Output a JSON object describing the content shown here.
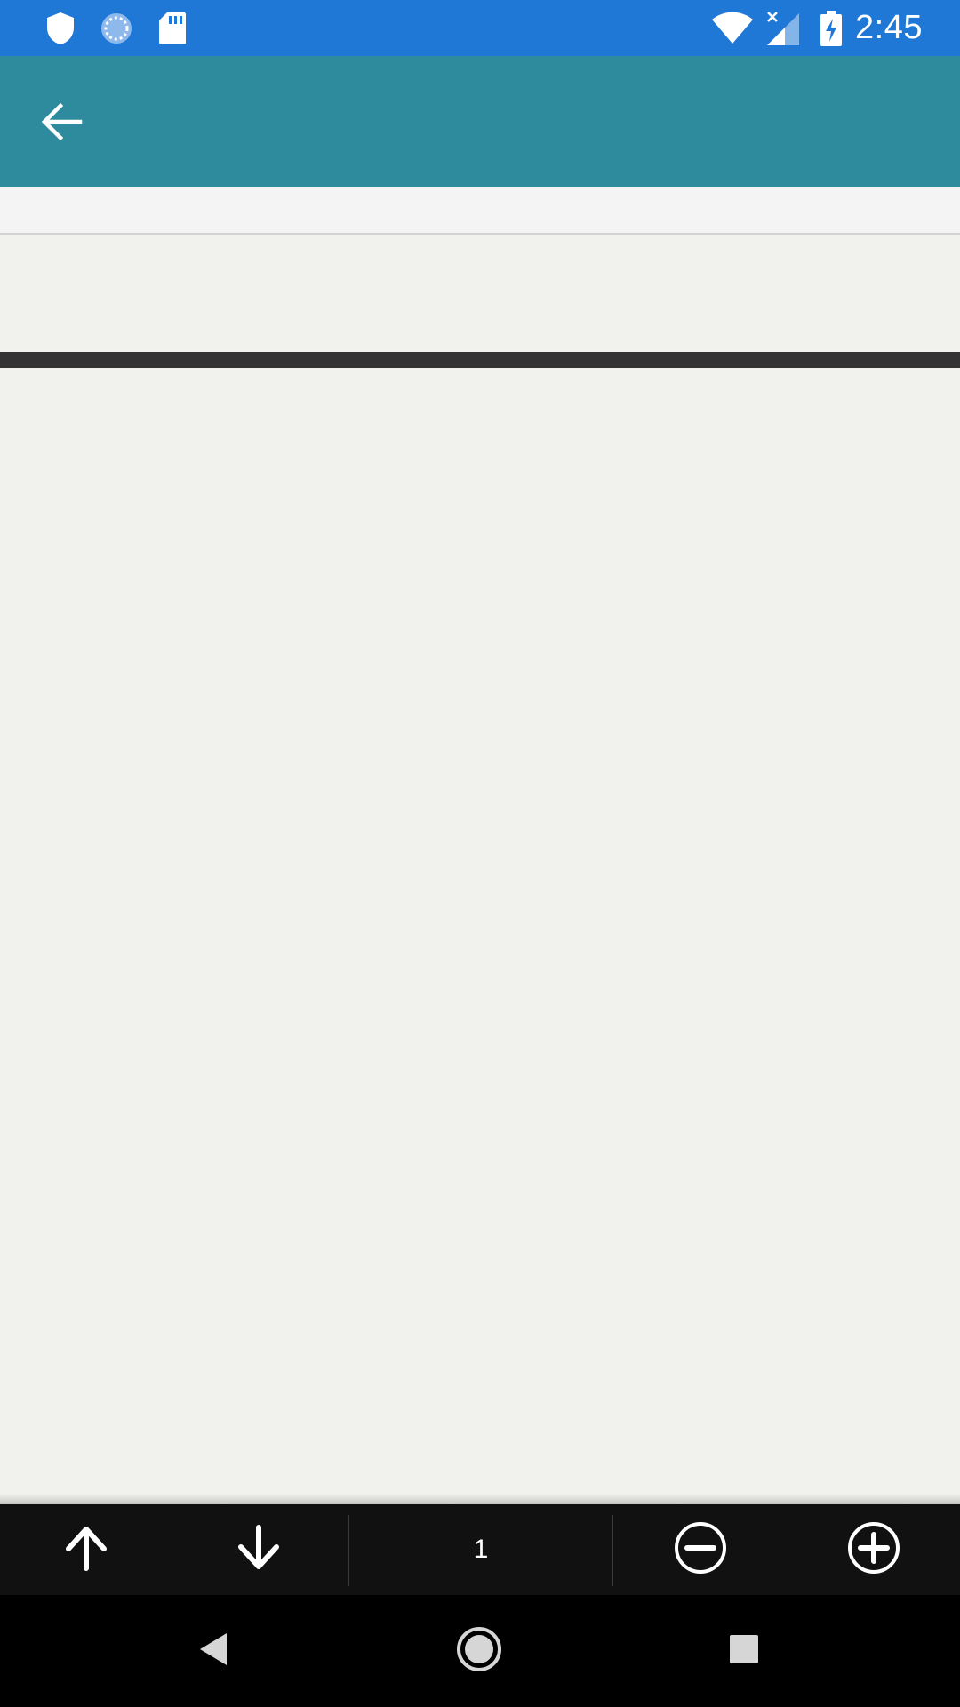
{
  "status_bar": {
    "time": "2:45",
    "left_icons": [
      "shield-icon",
      "sync-icon",
      "sd-card-icon"
    ],
    "right_icons": [
      "wifi-icon",
      "no-signal-icon",
      "battery-charging-icon"
    ],
    "background_color": "#1f78d6"
  },
  "app_bar": {
    "back_icon": "arrow-back-icon",
    "background_color": "#2e8b9d"
  },
  "toolbar": {
    "prev_icon": "arrow-up-icon",
    "next_icon": "arrow-down-icon",
    "page_number": "1",
    "zoom_out_icon": "zoom-out-icon",
    "zoom_in_icon": "zoom-in-icon",
    "background_color": "#111111"
  },
  "nav_bar": {
    "back_icon": "nav-back-icon",
    "home_icon": "nav-home-icon",
    "recents_icon": "nav-recents-icon"
  }
}
